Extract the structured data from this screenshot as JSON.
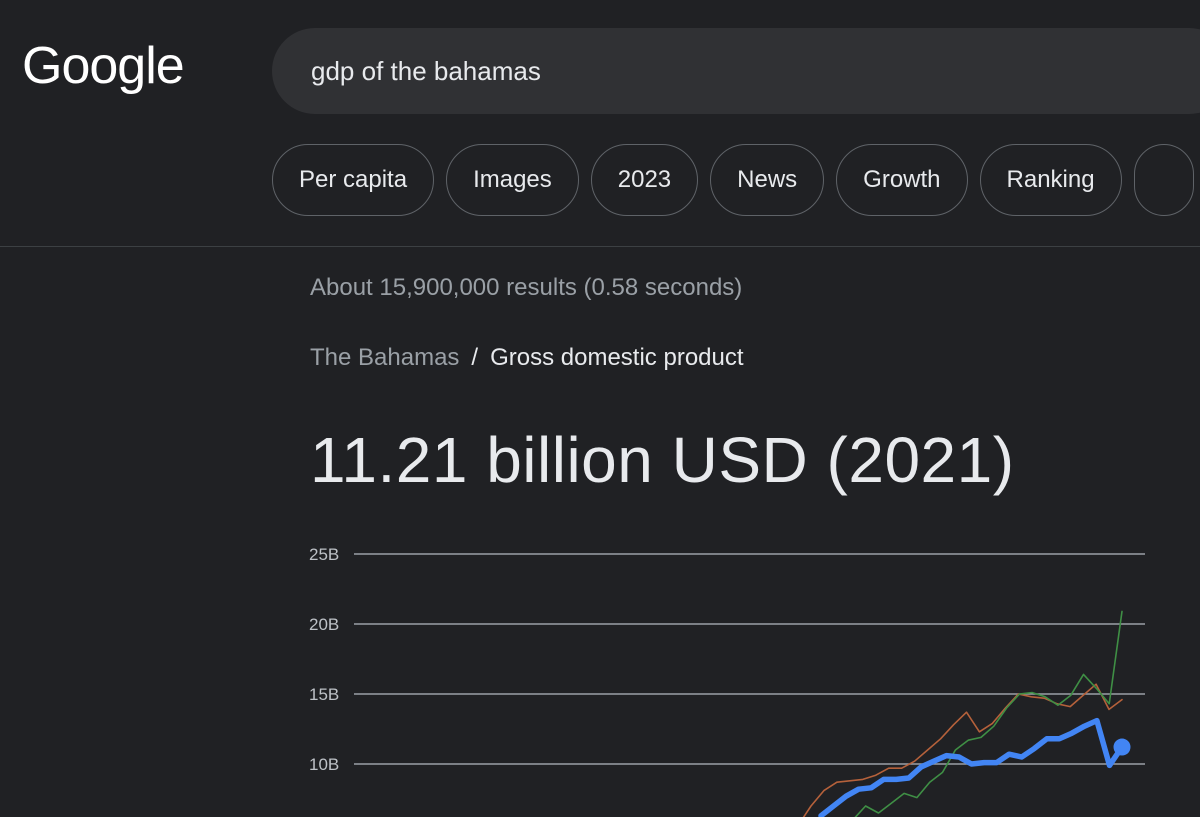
{
  "logo": {
    "text": "Google"
  },
  "search": {
    "query": "gdp of the bahamas"
  },
  "chips": [
    "Per capita",
    "Images",
    "2023",
    "News",
    "Growth",
    "Ranking"
  ],
  "result_stats": "About 15,900,000 results (0.58 seconds)",
  "breadcrumb": {
    "parent": "The Bahamas",
    "separator": "/",
    "current": "Gross domestic product"
  },
  "answer": {
    "value": "11.21 billion USD (2021)"
  },
  "chart_data": {
    "type": "line",
    "y_ticks": [
      "25B",
      "20B",
      "15B",
      "10B"
    ],
    "y_tick_values": [
      25,
      20,
      15,
      10
    ],
    "ylim_visible": [
      10,
      25
    ],
    "series": [
      {
        "color": "#4285f4",
        "values": [
          6.3,
          7.0,
          7.7,
          8.2,
          8.3,
          8.9,
          8.9,
          9.0,
          9.8,
          10.2,
          10.6,
          10.5,
          10.0,
          10.1,
          10.1,
          10.7,
          10.5,
          11.1,
          11.8,
          11.8,
          12.2,
          12.7,
          13.1,
          9.9,
          11.21
        ],
        "highlight_last": true
      },
      {
        "color": "#b5613b",
        "values": [
          5.6,
          7.0,
          8.1,
          8.7,
          8.8,
          8.9,
          9.2,
          9.7,
          9.7,
          10.2,
          11.0,
          11.8,
          12.8,
          13.7,
          12.3,
          12.9,
          14.0,
          15.0,
          14.8,
          14.7,
          14.3,
          14.1,
          14.9,
          15.7,
          13.9,
          14.6
        ]
      },
      {
        "color": "#3f8f45",
        "values": [
          4.2,
          6.0,
          7.0,
          6.5,
          7.2,
          7.9,
          7.6,
          8.7,
          9.4,
          11.0,
          11.7,
          11.9,
          12.7,
          14.0,
          15.0,
          15.1,
          14.8,
          14.2,
          14.9,
          16.4,
          15.4,
          14.3,
          20.9
        ]
      }
    ]
  }
}
